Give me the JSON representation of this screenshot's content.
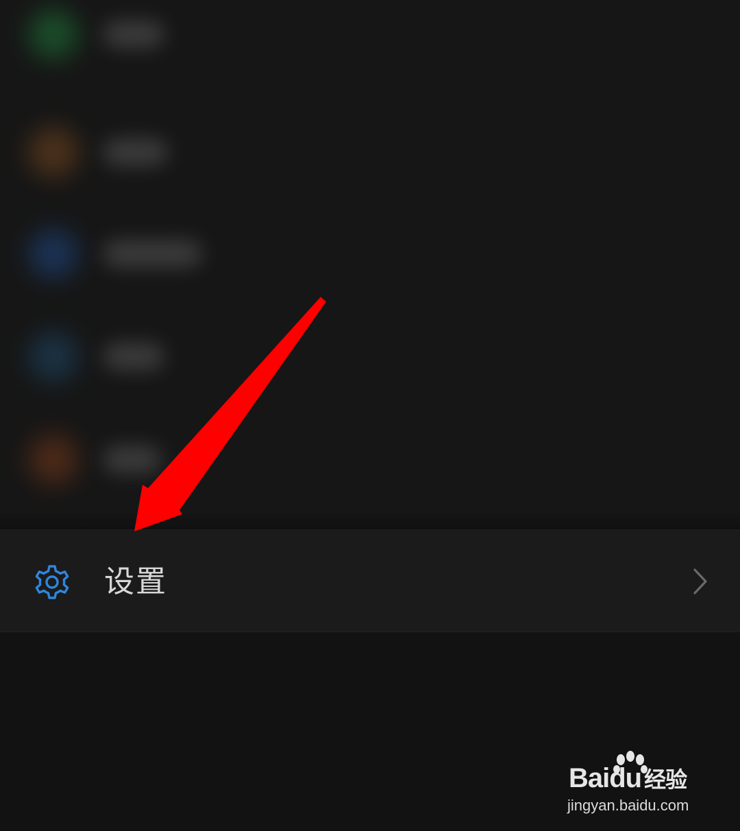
{
  "menu": {
    "settings": {
      "label": "设置",
      "icon": "gear-icon",
      "chevron": "chevron-right-icon"
    }
  },
  "colors": {
    "background": "#141414",
    "row_background": "#1b1b1b",
    "accent_blue": "#2f86de",
    "label_text": "#d8d8d8",
    "annotation_arrow": "#ff0000"
  },
  "watermark": {
    "logo_text": "Bai",
    "logo_text_du": "du",
    "logo_text_jingyan": "经验",
    "url": "jingyan.baidu.com"
  }
}
